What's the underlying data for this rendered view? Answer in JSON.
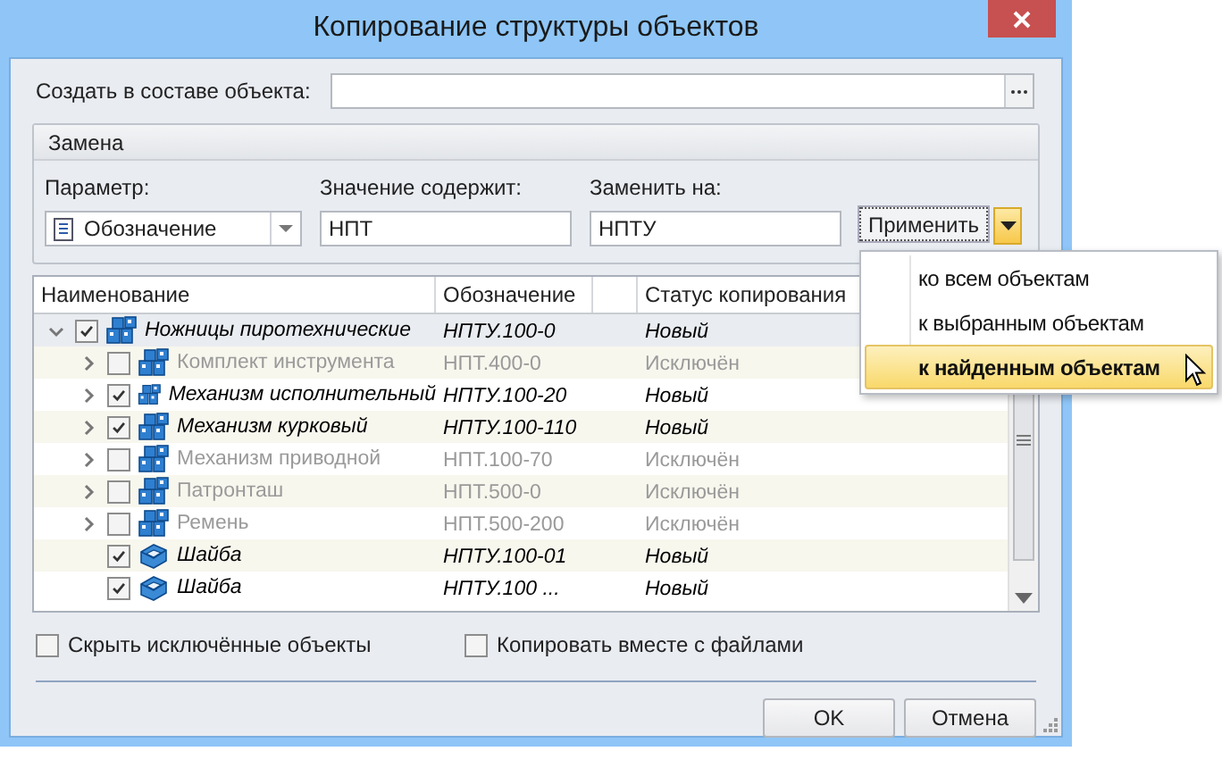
{
  "window": {
    "title": "Копирование структуры объектов"
  },
  "parent_field": {
    "label": "Создать в составе объекта:"
  },
  "replace_group": {
    "title": "Замена",
    "parameter": {
      "label": "Параметр:",
      "value": "Обозначение"
    },
    "contains": {
      "label": "Значение содержит:",
      "value": "НПТ"
    },
    "replace_with": {
      "label": "Заменить на:",
      "value": "НПТУ"
    },
    "apply_button": "Применить",
    "menu": {
      "open": true,
      "items": [
        {
          "label": "ко всем объектам",
          "selected": false
        },
        {
          "label": "к выбранным объектам",
          "selected": false
        },
        {
          "label": "к найденным объектам",
          "selected": true
        }
      ]
    }
  },
  "grid": {
    "columns": [
      "Наименование",
      "Обозначение",
      "Статус копирования"
    ],
    "rows": [
      {
        "kind": "assembly",
        "name": "Ножницы пиротехнические",
        "designation": "НПТУ.100-0",
        "status": "Новый",
        "checked": true,
        "expanded": true,
        "selected": true,
        "children": [
          {
            "kind": "assembly",
            "name": "Комплект инструмента",
            "designation": "НПТ.400-0",
            "status": "Исключён",
            "checked": false,
            "expanded": false,
            "selected": false
          },
          {
            "kind": "assembly",
            "name": "Механизм исполнительный",
            "designation": "НПТУ.100-20",
            "status": "Новый",
            "checked": true,
            "expanded": false,
            "selected": false
          },
          {
            "kind": "assembly",
            "name": "Механизм курковый",
            "designation": "НПТУ.100-110",
            "status": "Новый",
            "checked": true,
            "expanded": false,
            "selected": false
          },
          {
            "kind": "assembly",
            "name": "Механизм приводной",
            "designation": "НПТ.100-70",
            "status": "Исключён",
            "checked": false,
            "expanded": false,
            "selected": false
          },
          {
            "kind": "assembly",
            "name": "Патронташ",
            "designation": "НПТ.500-0",
            "status": "Исключён",
            "checked": false,
            "expanded": false,
            "selected": false
          },
          {
            "kind": "assembly",
            "name": "Ремень",
            "designation": "НПТ.500-200",
            "status": "Исключён",
            "checked": false,
            "expanded": false,
            "selected": false
          },
          {
            "kind": "part",
            "name": "Шайба",
            "designation": "НПТУ.100-01",
            "status": "Новый",
            "checked": true,
            "selected": false
          },
          {
            "kind": "part",
            "name": "Шайба",
            "designation": "НПТУ.100 ...",
            "status": "Новый",
            "checked": true,
            "selected": false
          }
        ]
      }
    ]
  },
  "options": [
    {
      "label": "Скрыть исключённые объекты",
      "checked": false
    },
    {
      "label": "Копировать вместе с файлами",
      "checked": false
    }
  ],
  "buttons": [
    "OK",
    "Отмена"
  ]
}
